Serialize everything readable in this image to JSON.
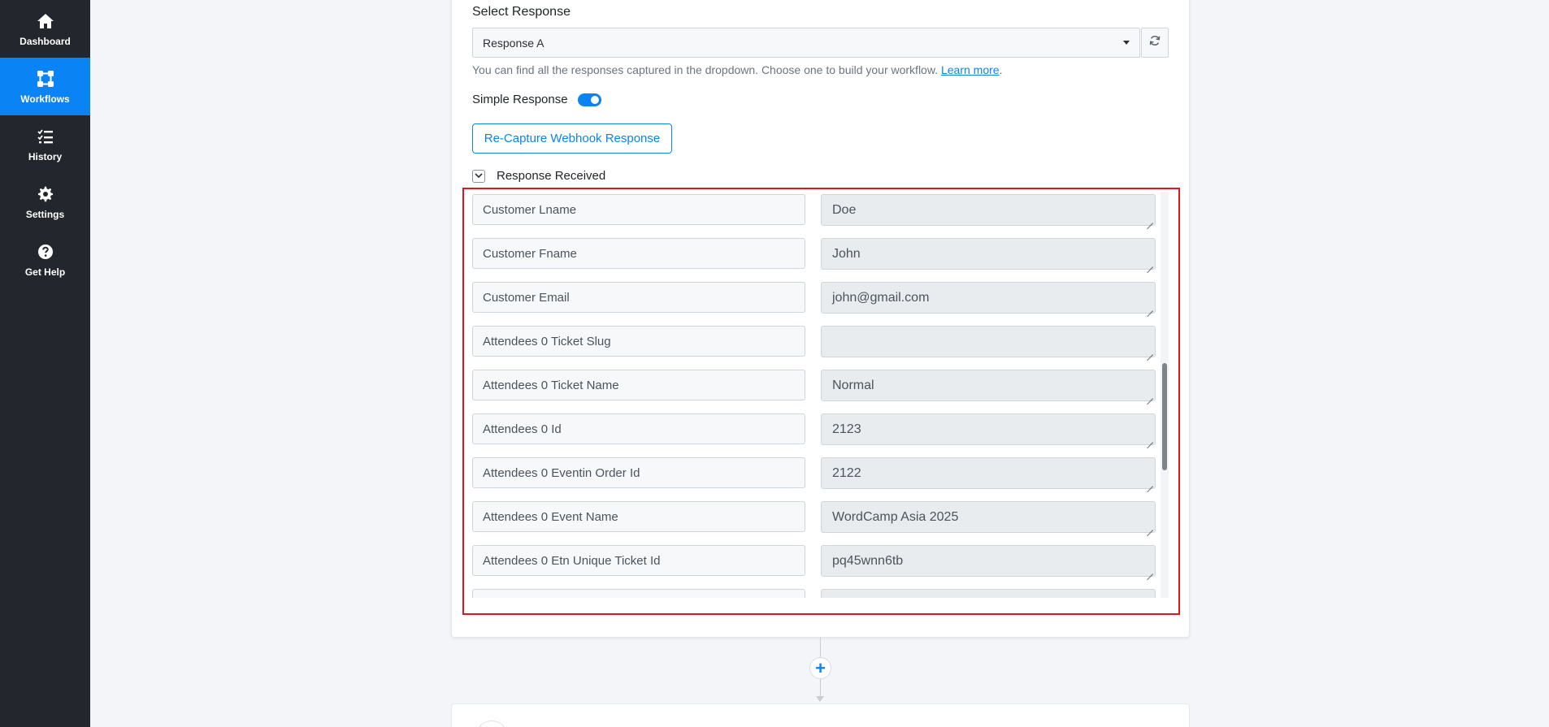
{
  "sidebar": {
    "items": [
      {
        "label": "Dashboard",
        "icon": "home-icon"
      },
      {
        "label": "Workflows",
        "icon": "workflow-icon",
        "active": true
      },
      {
        "label": "History",
        "icon": "list-icon"
      },
      {
        "label": "Settings",
        "icon": "gear-icon"
      },
      {
        "label": "Get Help",
        "icon": "question-icon"
      }
    ]
  },
  "response": {
    "select_label": "Select Response",
    "selected": "Response A",
    "help_text": "You can find all the responses captured in the dropdown. Choose one to build your workflow.",
    "learn_more": "Learn more",
    "simple_response_label": "Simple Response",
    "simple_response_on": true,
    "recapture_label": "Re-Capture Webhook Response",
    "received_label": "Response Received"
  },
  "fields": [
    {
      "key": "Customer Lname",
      "value": "Doe"
    },
    {
      "key": "Customer Fname",
      "value": "John"
    },
    {
      "key": "Customer Email",
      "value": "john@gmail.com"
    },
    {
      "key": "Attendees 0 Ticket Slug",
      "value": ""
    },
    {
      "key": "Attendees 0 Ticket Name",
      "value": "Normal"
    },
    {
      "key": "Attendees 0 Id",
      "value": "2123"
    },
    {
      "key": "Attendees 0 Eventin Order Id",
      "value": "2122"
    },
    {
      "key": "Attendees 0 Event Name",
      "value": "WordCamp Asia 2025"
    },
    {
      "key": "Attendees 0 Etn Unique Ticket Id",
      "value": "pq45wnn6tb"
    },
    {
      "key": "",
      "value": ""
    }
  ],
  "colors": {
    "accent": "#0a84f5",
    "sidebar_bg": "#23272d",
    "highlight": "#e5131d"
  }
}
